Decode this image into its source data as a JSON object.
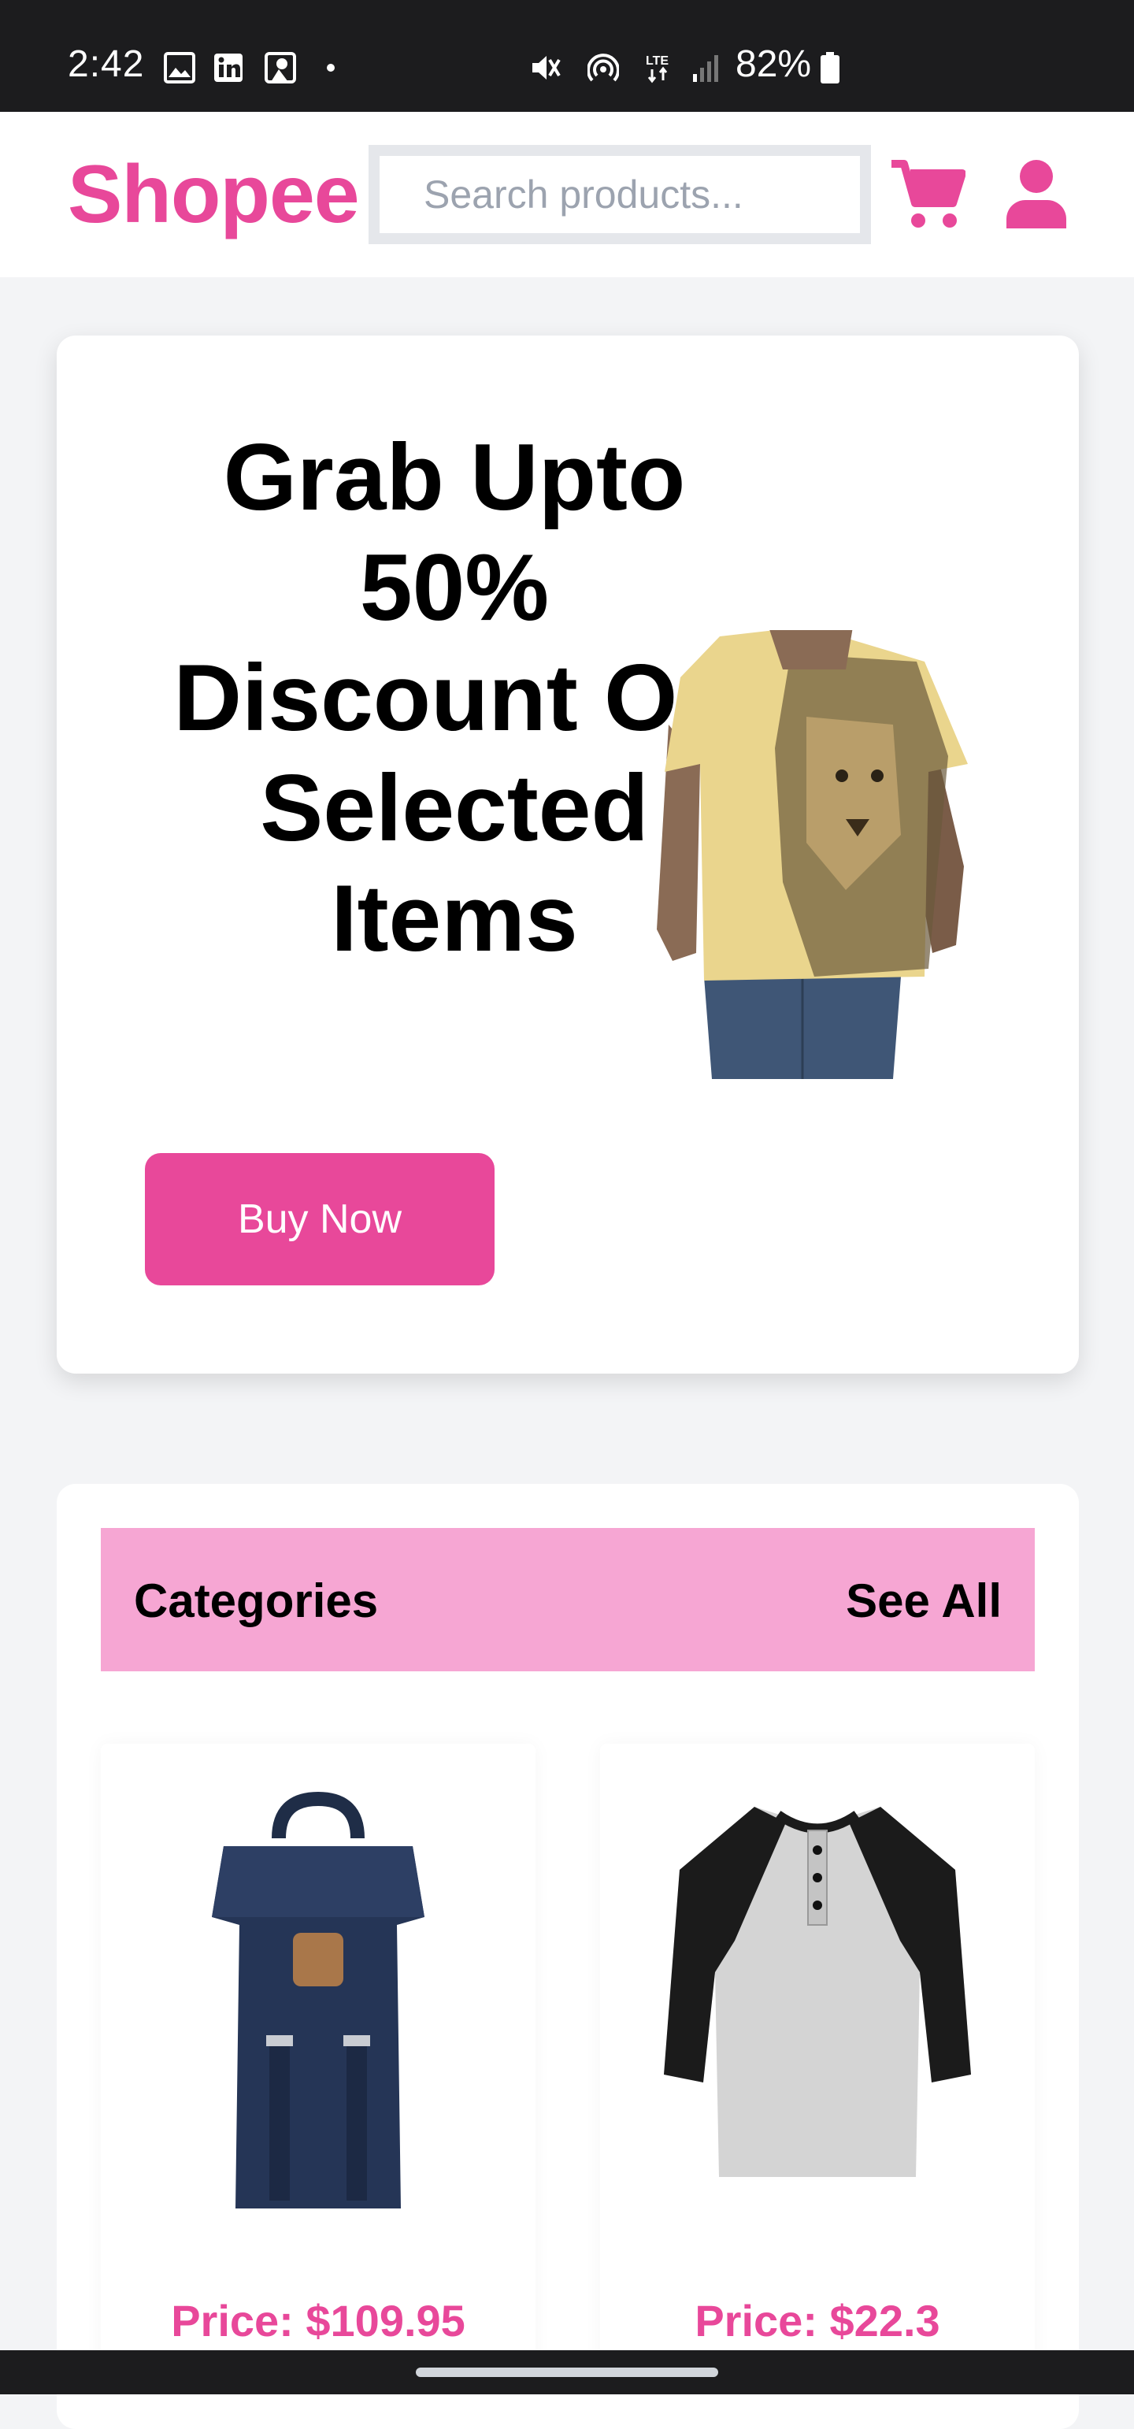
{
  "status_bar": {
    "time": "2:42",
    "battery": "82%",
    "icons": [
      "image-icon",
      "linkedin-icon",
      "app-icon",
      "dot-icon",
      "mute-icon",
      "hotspot-icon",
      "lte-icon",
      "signal-icon",
      "battery-icon"
    ],
    "lte_label": "LTE"
  },
  "header": {
    "brand": "Shopee",
    "search_placeholder": "Search products...",
    "icons": [
      "cart-icon",
      "user-icon"
    ],
    "accent_color": "#e8489a"
  },
  "hero": {
    "title": "Grab Upto 50% Discount On Selected Items",
    "button_label": "Buy Now"
  },
  "categories": {
    "title": "Categories",
    "see_all": "See All",
    "products": [
      {
        "price": "Price: $109.95",
        "image": "backpack"
      },
      {
        "price": "Price: $22.3",
        "image": "raglan-shirt"
      }
    ]
  }
}
